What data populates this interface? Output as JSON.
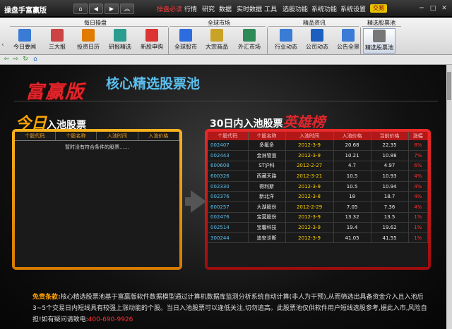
{
  "app": {
    "title": "操盘手富赢版"
  },
  "menu": [
    {
      "label": "操盘必读",
      "active": true
    },
    {
      "label": "行情"
    },
    {
      "label": "研究"
    },
    {
      "label": "数据"
    },
    {
      "label": "实时数据"
    },
    {
      "label": "工具"
    },
    {
      "label": "选股功能"
    },
    {
      "label": "系统功能"
    },
    {
      "label": "系统设置"
    }
  ],
  "badge": "交易",
  "toolbar": {
    "groups": [
      "每日操盘",
      "全球市场",
      "精品资讯",
      "精选股票池"
    ],
    "tools": [
      {
        "label": "今日要闻",
        "icon": "newspaper-icon",
        "color": "#3a7bd5"
      },
      {
        "label": "三大报",
        "icon": "report-icon",
        "color": "#c44"
      },
      {
        "label": "投资日历",
        "icon": "calendar-icon",
        "color": "#e07b00"
      },
      {
        "label": "研报精选",
        "icon": "research-icon",
        "color": "#2a9d8f"
      },
      {
        "label": "新股申购",
        "icon": "ipo-icon",
        "color": "#d33"
      },
      {
        "label": "全球股市",
        "icon": "globe-icon",
        "color": "#2d6cdf"
      },
      {
        "label": "大宗商品",
        "icon": "commodity-icon",
        "color": "#c9a227"
      },
      {
        "label": "外汇市场",
        "icon": "forex-icon",
        "color": "#2e8b57"
      },
      {
        "label": "行业动态",
        "icon": "industry-icon",
        "color": "#3a7bd5"
      },
      {
        "label": "公司动态",
        "icon": "company-icon",
        "color": "#1d5fbf"
      },
      {
        "label": "公告全景",
        "icon": "announce-icon",
        "color": "#3a7bd5"
      },
      {
        "label": "精选股票池",
        "icon": "printer-icon",
        "color": "#777",
        "selected": true
      }
    ]
  },
  "page": {
    "logo": "富赢版",
    "logo_sub": "核心精选股票池",
    "left_head_big": "今日",
    "left_head_small": "入池股票",
    "right_head_small": "30日内入池股票",
    "right_head_big": "英雄榜"
  },
  "left_table": {
    "headers": [
      "个股代码",
      "个股名称",
      "入池时间",
      "入池价格"
    ],
    "empty": "暂时没有符合条件的股票……"
  },
  "right_table": {
    "headers": [
      "个股代码",
      "个股名称",
      "入池时间",
      "入池价格",
      "当前价格",
      "涨幅"
    ],
    "rows": [
      [
        "002407",
        "多氟多",
        "2012-3-9",
        "20.68",
        "22.35",
        "8%"
      ],
      [
        "002443",
        "金洲管道",
        "2012-3-9",
        "10.21",
        "10.88",
        "7%"
      ],
      [
        "600608",
        "ST沪科",
        "2012-2-27",
        "4.7",
        "4.97",
        "6%"
      ],
      [
        "600326",
        "西藏天路",
        "2012-3-21",
        "10.5",
        "10.93",
        "4%"
      ],
      [
        "002330",
        "得利斯",
        "2012-3-9",
        "10.5",
        "10.94",
        "4%"
      ],
      [
        "002376",
        "新北洋",
        "2012-3-8",
        "18",
        "18.7",
        "4%"
      ],
      [
        "600257",
        "大湖股份",
        "2012-2-29",
        "7.05",
        "7.36",
        "4%"
      ],
      [
        "002476",
        "宝莫股份",
        "2012-3-9",
        "13.32",
        "13.5",
        "1%"
      ],
      [
        "002514",
        "宝馨科技",
        "2012-3-9",
        "19.4",
        "19.62",
        "1%"
      ],
      [
        "300244",
        "迪安诊断",
        "2012-3-9",
        "41.05",
        "41.55",
        "1%"
      ]
    ]
  },
  "disclaimer": {
    "label": "免责条款:",
    "text": "核心精选股票池基于富赢版软件数据模型通过计算机数据库监测分析系统自动计算(非人为干预),从而筛选出具备资金介入且入池后3~5个交易日内短线具有较强上涨动能的个股。当日入池股票可以逢低关注,切勿追高。此股票池仅供软件用户短线选股参考,据此入市,风险自担!如有疑问请致电:",
    "phone": "400-690-9926"
  }
}
